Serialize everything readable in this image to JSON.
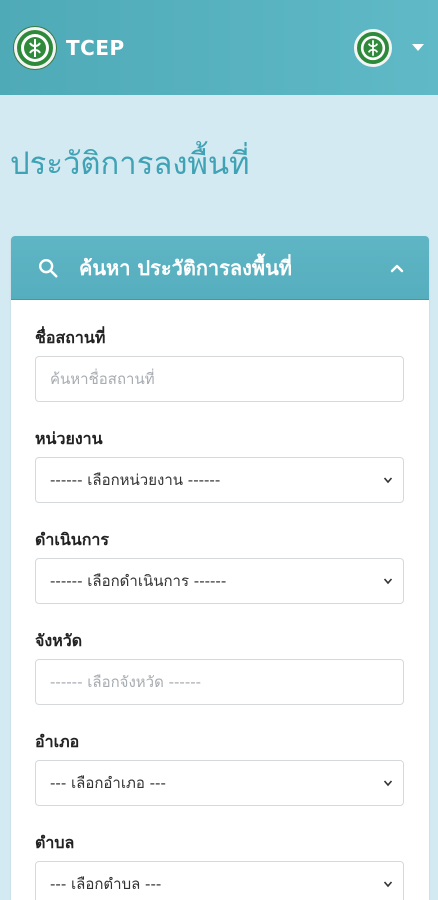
{
  "navbar": {
    "brand": "TCEP",
    "logo_icon": "department-seal-icon",
    "profile_icon": "department-seal-icon",
    "menu_icon": "caret-down-icon"
  },
  "page": {
    "title": "ประวัติการลงพื้นที่"
  },
  "card": {
    "title": "ค้นหา ประวัติการลงพื้นที่",
    "collapse_icon": "chevron-up-icon"
  },
  "form": {
    "place_name": {
      "label": "ชื่อสถานที่",
      "placeholder": "ค้นหาชื่อสถานที่",
      "value": ""
    },
    "agency": {
      "label": "หน่วยงาน",
      "selected": "------ เลือกหน่วยงาน ------"
    },
    "operation": {
      "label": "ดำเนินการ",
      "selected": "------ เลือกดำเนินการ ------"
    },
    "province": {
      "label": "จังหวัด",
      "placeholder": "------ เลือกจังหวัด ------"
    },
    "district": {
      "label": "อำเภอ",
      "selected": "--- เลือกอำเภอ ---"
    },
    "subdistrict": {
      "label": "ตำบล",
      "selected": "--- เลือกตำบล ---"
    }
  },
  "colors": {
    "navbar": "#55b0be",
    "page_bg": "#d4eaf2",
    "title": "#3fa3b5",
    "card_header": "#5ab2c1"
  }
}
